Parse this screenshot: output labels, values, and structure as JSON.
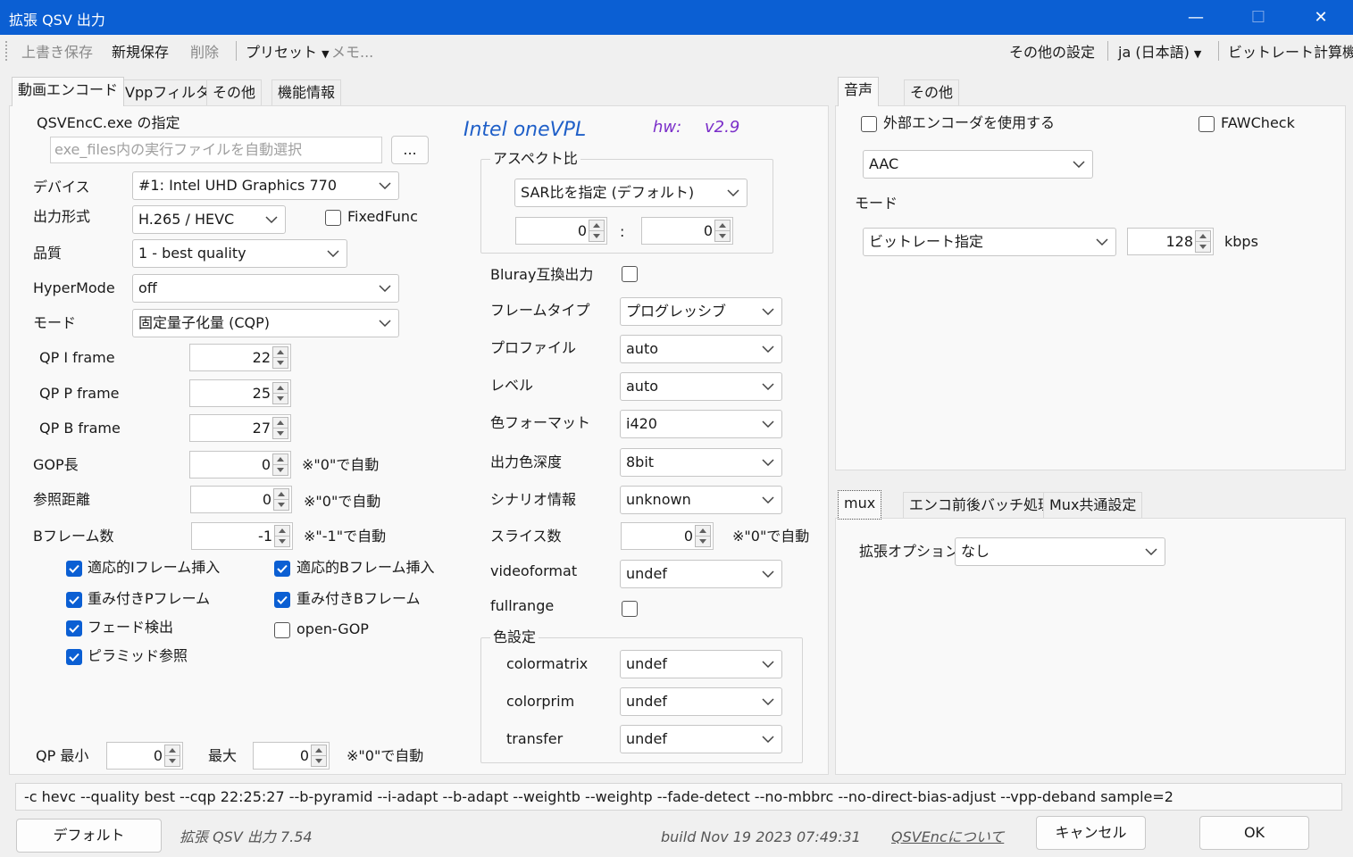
{
  "window": {
    "title": "拡張 QSV 出力",
    "minimize": "—",
    "maximize": "☐",
    "close": "✕"
  },
  "toolbar": {
    "overwrite_save": "上書き保存",
    "new_save": "新規保存",
    "delete": "削除",
    "preset": "プリセット",
    "memo": "メモ...",
    "other_settings": "その他の設定",
    "language": "ja (日本語)",
    "bitrate_calc": "ビットレート計算機"
  },
  "tabs_left": [
    "動画エンコード",
    "Vppフィルタ",
    "その他",
    "機能情報"
  ],
  "tabs_audio": [
    "音声",
    "その他"
  ],
  "tabs_mux": [
    "mux",
    "エンコ前後バッチ処理",
    "Mux共通設定"
  ],
  "encoder": {
    "exe_label": "QSVEncC.exe の指定",
    "exe_placeholder": "exe_files内の実行ファイルを自動選択",
    "browse": "...",
    "device_label": "デバイス",
    "device_value": "#1: Intel UHD Graphics 770",
    "output_label": "出力形式",
    "output_value": "H.265 / HEVC",
    "fixedfunc_label": "FixedFunc",
    "quality_label": "品質",
    "quality_value": "1 - best quality",
    "hypermode_label": "HyperMode",
    "hypermode_value": "off",
    "mode_label": "モード",
    "mode_value": "固定量子化量 (CQP)",
    "qpi_label": "QP I frame",
    "qpi_value": "22",
    "qpp_label": "QP P frame",
    "qpp_value": "25",
    "qpb_label": "QP B frame",
    "qpb_value": "27",
    "gop_label": "GOP長",
    "gop_value": "0",
    "gop_note": "※\"0\"で自動",
    "ref_label": "参照距離",
    "ref_value": "0",
    "ref_note": "※\"0\"で自動",
    "bframes_label": "Bフレーム数",
    "bframes_value": "-1",
    "bframes_note": "※\"-1\"で自動",
    "adaptive_i": "適応的Iフレーム挿入",
    "adaptive_b": "適応的Bフレーム挿入",
    "weighted_p": "重み付きPフレーム",
    "weighted_b": "重み付きBフレーム",
    "fade_detect": "フェード検出",
    "open_gop": "open-GOP",
    "pyramid": "ピラミッド参照",
    "qpmin_label": "QP 最小",
    "qpmin_value": "0",
    "qpmax_label": "最大",
    "qpmax_value": "0",
    "qp_note": "※\"0\"で自動"
  },
  "vpl": {
    "name": "Intel oneVPL",
    "hw_label": "hw:",
    "hw_version": "v2.9"
  },
  "aspect": {
    "caption": "アスペクト比",
    "mode": "SAR比を指定 (デフォルト)",
    "w": "0",
    "sep": ":",
    "h": "0"
  },
  "video": {
    "bluray_label": "Bluray互換出力",
    "frametype_label": "フレームタイプ",
    "frametype_value": "プログレッシブ",
    "profile_label": "プロファイル",
    "profile_value": "auto",
    "level_label": "レベル",
    "level_value": "auto",
    "colorformat_label": "色フォーマット",
    "colorformat_value": "i420",
    "depth_label": "出力色深度",
    "depth_value": "8bit",
    "scenario_label": "シナリオ情報",
    "scenario_value": "unknown",
    "slice_label": "スライス数",
    "slice_value": "0",
    "slice_note": "※\"0\"で自動",
    "videoformat_label": "videoformat",
    "videoformat_value": "undef",
    "fullrange_label": "fullrange"
  },
  "color": {
    "caption": "色設定",
    "matrix_label": "colormatrix",
    "matrix_value": "undef",
    "prim_label": "colorprim",
    "prim_value": "undef",
    "transfer_label": "transfer",
    "transfer_value": "undef"
  },
  "audio": {
    "external_label": "外部エンコーダを使用する",
    "faw_label": "FAWCheck",
    "codec": "AAC",
    "mode_label": "モード",
    "mode_value": "ビットレート指定",
    "bitrate": "128",
    "unit": "kbps"
  },
  "mux": {
    "ext_label": "拡張オプション",
    "ext_value": "なし"
  },
  "cmdline": "-c hevc --quality best --cqp 22:25:27 --b-pyramid --i-adapt --b-adapt --weightb --weightp --fade-detect --no-mbbrc --no-direct-bias-adjust --vpp-deband sample=2",
  "footer": {
    "default_btn": "デフォルト",
    "version": "拡張 QSV 出力 7.54",
    "build": "build Nov 19 2023 07:49:31",
    "about": "QSVEncについて",
    "cancel": "キャンセル",
    "ok": "OK"
  },
  "colors": {
    "titlebar": "#0b5fd3",
    "accent": "#0b5fd3",
    "vpl_name": "#1f5fc8",
    "vpl_hw": "#7b2fc9"
  }
}
